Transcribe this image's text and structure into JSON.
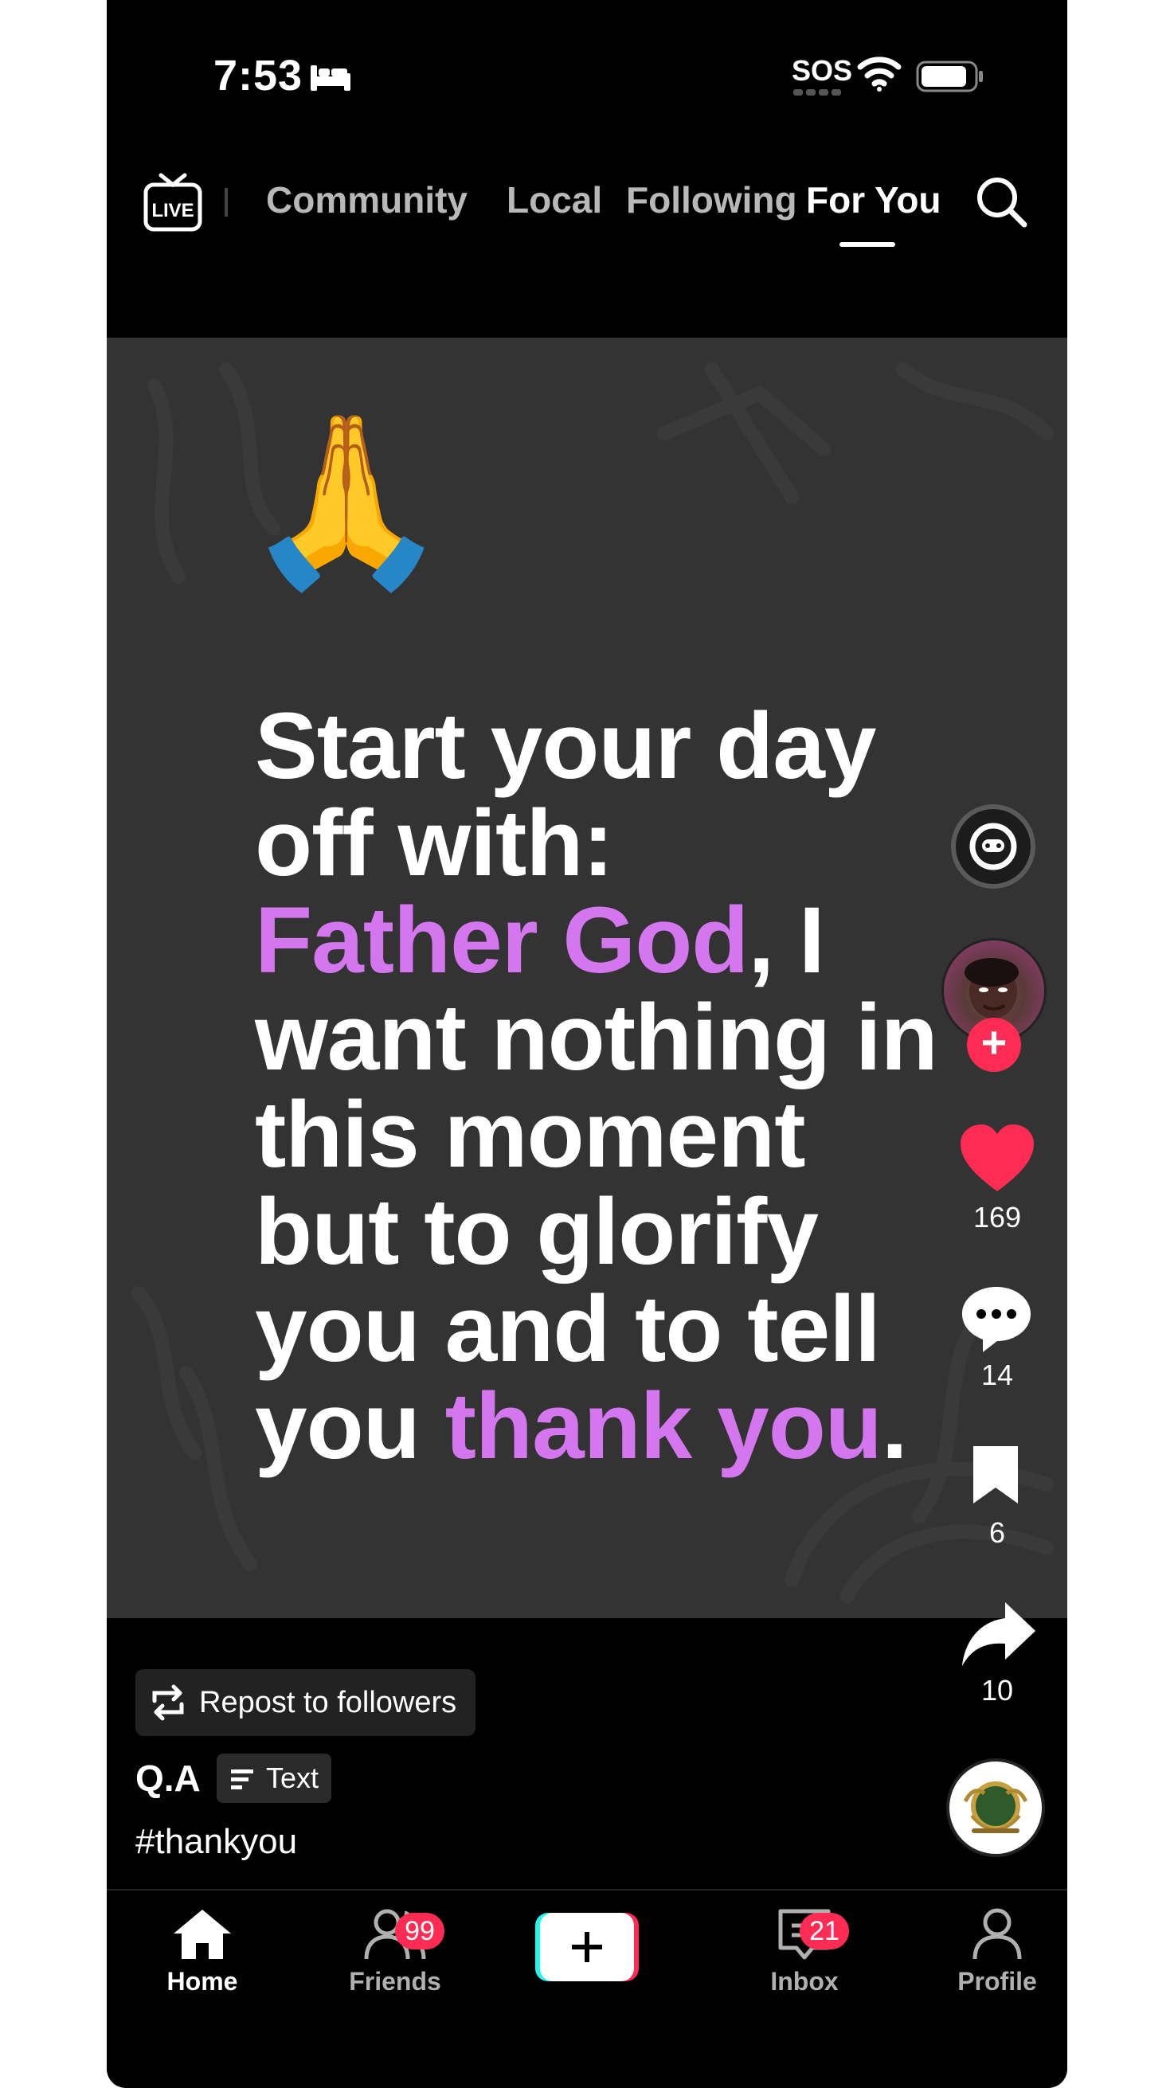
{
  "status_bar": {
    "time": "7:53",
    "sos": "SOS",
    "icons": [
      "sleep-focus-icon",
      "wifi-icon",
      "battery-icon"
    ]
  },
  "top_nav": {
    "live_label": "LIVE",
    "tabs": [
      {
        "label": "Community",
        "active": false
      },
      {
        "label": "Local",
        "active": false
      },
      {
        "label": "Following",
        "active": false
      },
      {
        "label": "For You",
        "active": true
      }
    ]
  },
  "post": {
    "emoji": "🙏",
    "quote_lines": {
      "l1": "Start your day",
      "l2": "off with:",
      "l3_highlight": "Father God",
      "l3_rest": ", I",
      "l4": "want nothing in",
      "l5": "this moment",
      "l6": "but to glorify",
      "l7": "you and to tell",
      "l8_prefix": "you ",
      "l8_highlight": "thank you",
      "l8_suffix": "."
    },
    "highlight_color": "#d477ef",
    "likes": "169",
    "comments": "14",
    "bookmarks": "6",
    "shares": "10",
    "repost_label": "Repost to followers",
    "author": "Q.A",
    "type_badge": "Text",
    "caption": "#thankyou"
  },
  "bottom_nav": {
    "home": "Home",
    "friends": "Friends",
    "friends_badge": "99",
    "inbox": "Inbox",
    "inbox_badge": "21",
    "profile": "Profile"
  },
  "colors": {
    "background": "#000000",
    "card": "#333333",
    "accent_red": "#fe2c55",
    "accent_purple": "#d477ef"
  }
}
